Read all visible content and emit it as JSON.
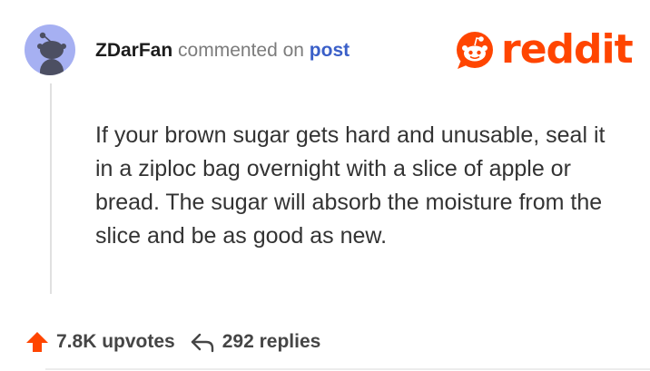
{
  "comment": {
    "username": "ZDarFan",
    "action_text": "commented on",
    "post_link": "post",
    "body": "If your brown sugar gets hard and unusable, seal it in a ziploc bag overnight with a slice of apple or bread. The sugar will absorb the moisture from the slice and be as good as new."
  },
  "brand": {
    "name": "reddit",
    "icon": "reddit-snoo-icon",
    "color": "#ff4500"
  },
  "avatar": {
    "icon": "snoo-avatar-icon",
    "background": "#a6b0f2"
  },
  "footer": {
    "upvotes": "7.8K upvotes",
    "upvote_icon": "upvote-arrow-icon",
    "upvote_color": "#ff4500",
    "replies": "292 replies",
    "reply_icon": "reply-arrow-icon"
  }
}
